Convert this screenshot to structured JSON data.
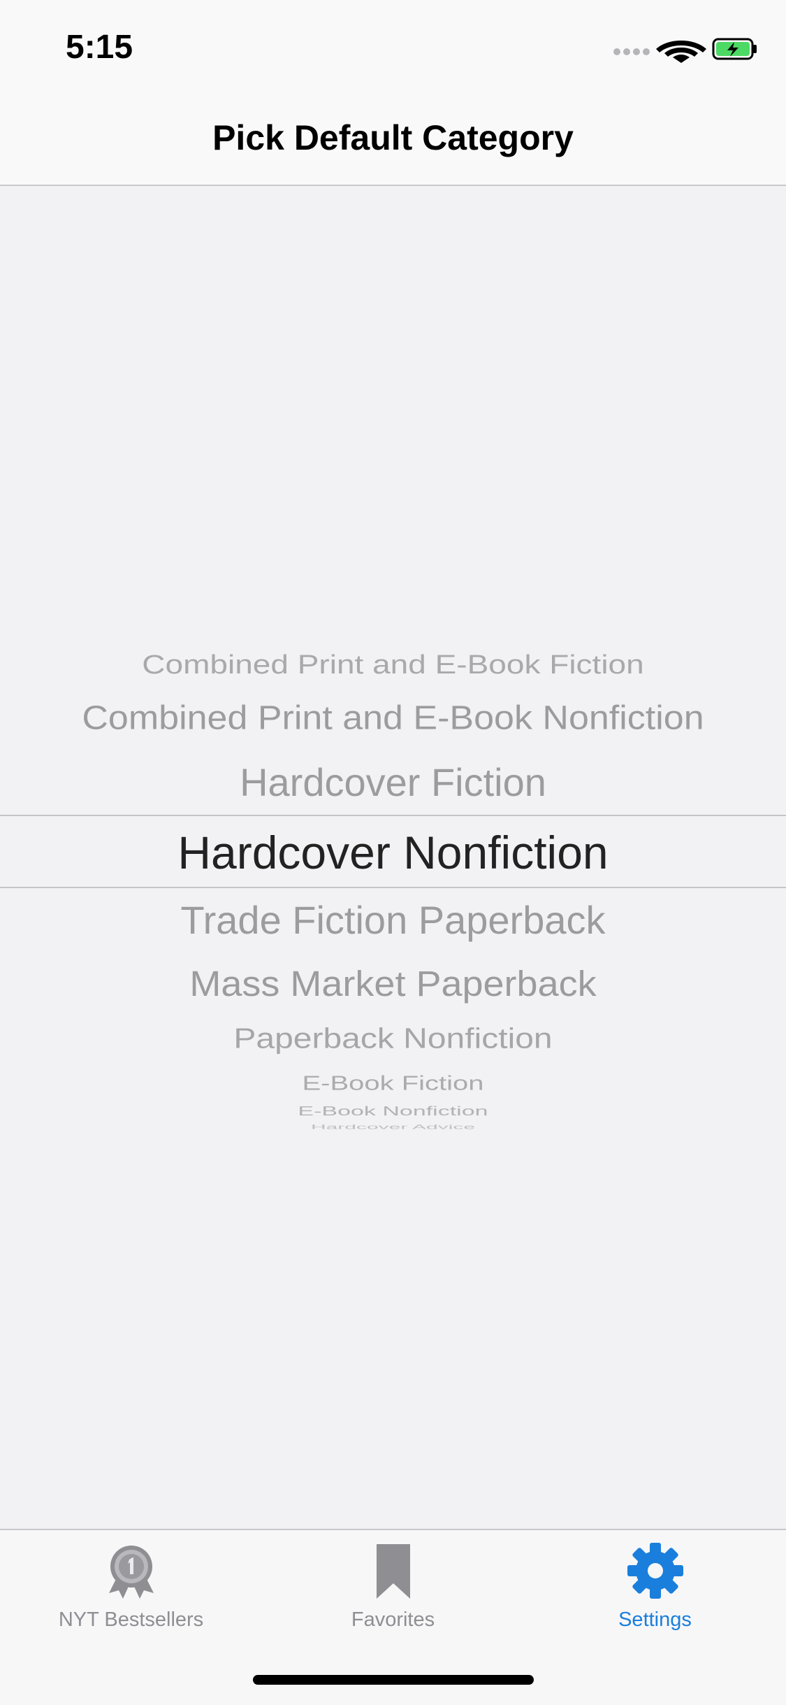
{
  "status_bar": {
    "time": "5:15"
  },
  "nav": {
    "title": "Pick Default Category"
  },
  "picker": {
    "items": [
      "Combined Print and E-Book Fiction",
      "Combined Print and E-Book Nonfiction",
      "Hardcover Fiction",
      "Hardcover Nonfiction",
      "Trade Fiction Paperback",
      "Mass Market Paperback",
      "Paperback Nonfiction",
      "E-Book Fiction",
      "E-Book Nonfiction",
      "Hardcover Advice"
    ],
    "selected": "Hardcover Nonfiction"
  },
  "tabs": [
    {
      "label": "NYT Bestsellers",
      "icon": "award-ribbon-icon",
      "active": false
    },
    {
      "label": "Favorites",
      "icon": "bookmark-icon",
      "active": false
    },
    {
      "label": "Settings",
      "icon": "gear-icon",
      "active": true
    }
  ],
  "colors": {
    "accent": "#1a7fdc",
    "tab_inactive": "#8e8e93",
    "picker_text": "#9c9c9e",
    "picker_selected": "#222222",
    "battery": "#4cd964"
  }
}
